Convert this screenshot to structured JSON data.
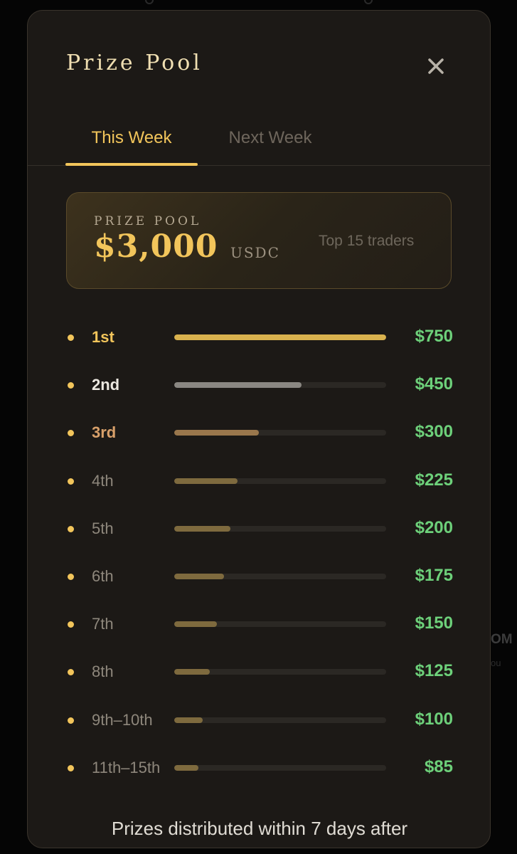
{
  "modal": {
    "title": "Prize Pool",
    "close_icon": "close-icon"
  },
  "tabs": [
    {
      "label": "This Week",
      "active": true
    },
    {
      "label": "Next Week",
      "active": false
    }
  ],
  "pool": {
    "label": "PRIZE POOL",
    "amount": "$3,000",
    "currency": "USDC",
    "subtitle": "Top 15 traders"
  },
  "ranks": [
    {
      "label": "1st",
      "prize": "$750",
      "fill": 1.0,
      "label_color": "#f2c55b",
      "bar_color": "#d9b24e"
    },
    {
      "label": "2nd",
      "prize": "$450",
      "fill": 0.6,
      "label_color": "#ece8e0",
      "bar_color": "#8a8782"
    },
    {
      "label": "3rd",
      "prize": "$300",
      "fill": 0.4,
      "label_color": "#d8a06a",
      "bar_color": "#9a774c"
    },
    {
      "label": "4th",
      "prize": "$225",
      "fill": 0.3,
      "label_color": "#8e877c",
      "bar_color": "#7e6a3e"
    },
    {
      "label": "5th",
      "prize": "$200",
      "fill": 0.2667,
      "label_color": "#8e877c",
      "bar_color": "#7e6a3e"
    },
    {
      "label": "6th",
      "prize": "$175",
      "fill": 0.2333,
      "label_color": "#8e877c",
      "bar_color": "#7e6a3e"
    },
    {
      "label": "7th",
      "prize": "$150",
      "fill": 0.2,
      "label_color": "#8e877c",
      "bar_color": "#7e6a3e"
    },
    {
      "label": "8th",
      "prize": "$125",
      "fill": 0.1667,
      "label_color": "#8e877c",
      "bar_color": "#7e6a3e"
    },
    {
      "label": "9th–10th",
      "prize": "$100",
      "fill": 0.1333,
      "label_color": "#8e877c",
      "bar_color": "#7e6a3e"
    },
    {
      "label": "11th–15th",
      "prize": "$85",
      "fill": 0.1133,
      "label_color": "#8e877c",
      "bar_color": "#7e6a3e"
    }
  ],
  "footer": {
    "text": "Prizes distributed within 7 days after"
  },
  "background": {
    "partial_text_1": "OM",
    "partial_text_2": "ou"
  },
  "colors": {
    "accent": "#f2c55b",
    "prize_green": "#6dd07a",
    "modal_bg": "#1c1916"
  }
}
